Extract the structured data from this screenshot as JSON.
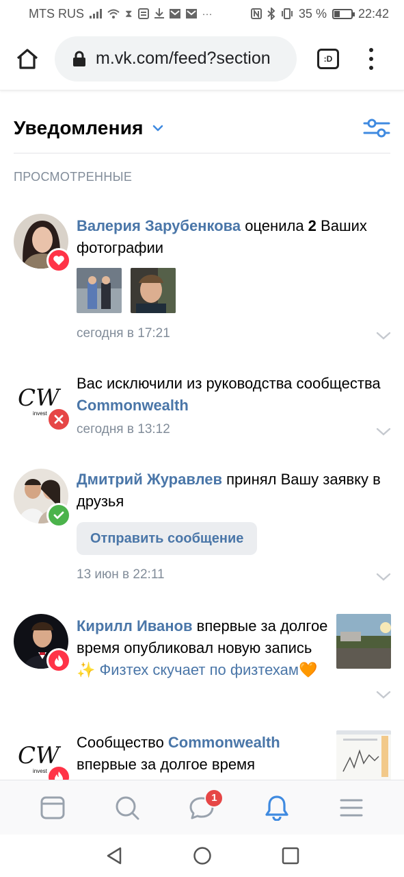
{
  "status_bar": {
    "carrier": "MTS RUS",
    "battery_percent": "35 %",
    "battery_level": 0.35,
    "time": "22:42"
  },
  "browser": {
    "url": "m.vk.com/feed?section",
    "tab_label": ":D"
  },
  "header": {
    "title": "Уведомления"
  },
  "section_label": "ПРОСМОТРЕННЫЕ",
  "notifications": [
    {
      "user": "Валерия Зарубенкова",
      "text_before": " оценила ",
      "count": "2",
      "text_after": " Ваших фотографии",
      "time": "сегодня в 17:21",
      "badge": "heart-icon"
    },
    {
      "text_before": "Вас исключили из руководства сообщества ",
      "group": "Commonwealth",
      "time": "сегодня в 13:12",
      "badge": "cross-icon"
    },
    {
      "user": "Дмитрий Журавлев",
      "text_after": " принял Вашу заявку в друзья",
      "button": "Отправить сообщение",
      "time": "13 июн в 22:11",
      "badge": "check-icon"
    },
    {
      "user": "Кирилл Иванов",
      "text_after": " впервые за долгое время опубликовал новую запись ",
      "sparkle": "✨",
      "post_text": " Физтех скучает по физтехам",
      "heart": "🧡",
      "badge": "fire-icon"
    },
    {
      "text_before": "Сообщество ",
      "group": "Commonwealth",
      "text_after": " впервые за долгое время",
      "badge": "fire-icon"
    }
  ],
  "bottom_nav": {
    "messages_badge": "1"
  },
  "colors": {
    "link": "#4a76a8",
    "secondary_text": "#818c99",
    "like_badge": "#ff3347",
    "remove_badge": "#e64646",
    "accept_badge": "#4bb34b",
    "active_tab": "#3f8ae0"
  },
  "avatars": {
    "commonwealth_logo_text": "CW",
    "commonwealth_logo_sub": "invest"
  }
}
